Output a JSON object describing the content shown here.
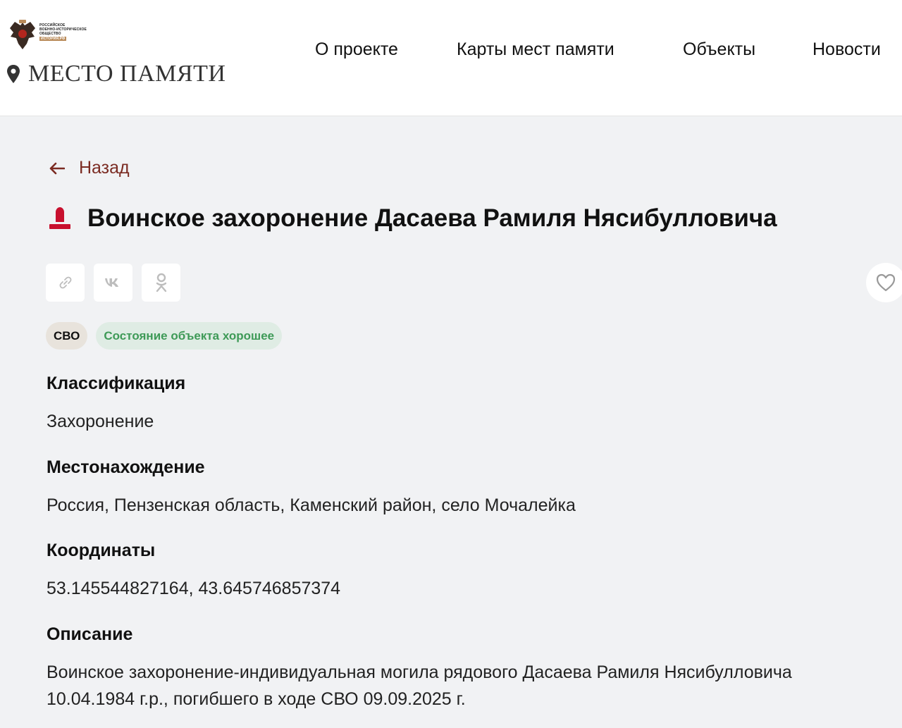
{
  "header": {
    "org_lines": [
      "РОССИЙСКОЕ",
      "ВОЕННО-ИСТОРИЧЕСКОЕ",
      "ОБЩЕСТВО"
    ],
    "org_tag": "ИСТОРИЯ.РФ",
    "site_name": "МЕСТО ПАМЯТИ",
    "nav": [
      "О проекте",
      "Карты мест памяти",
      "Объекты",
      "Новости"
    ]
  },
  "page": {
    "back_label": "Назад",
    "title": "Воинское захоронение Дасаева Рамиля Нясибулловича",
    "badges": {
      "category": "СВО",
      "state": "Состояние объекта хорошее"
    },
    "fields": [
      {
        "label": "Классификация",
        "value": "Захоронение"
      },
      {
        "label": "Местонахождение",
        "value": "Россия, Пензенская область, Каменский район, село Мочалейка"
      },
      {
        "label": "Координаты",
        "value": "53.145544827164, 43.645746857374"
      },
      {
        "label": "Описание",
        "value": "Воинское захоронение-индивидуальная могила рядового Дасаева Рамиля Нясибулловича 10.04.1984 г.р., погибшего в ходе СВО 09.09.2025 г."
      }
    ]
  },
  "icons": {
    "share": [
      "link-icon",
      "vk-icon",
      "odnoklassniki-icon"
    ],
    "favorite": "heart-icon",
    "object": "gravestone-icon"
  },
  "colors": {
    "accent": "#7b2b22",
    "object_icon": "#c8102e",
    "state_green": "#3e9a57",
    "page_bg": "#f1f2f4"
  }
}
